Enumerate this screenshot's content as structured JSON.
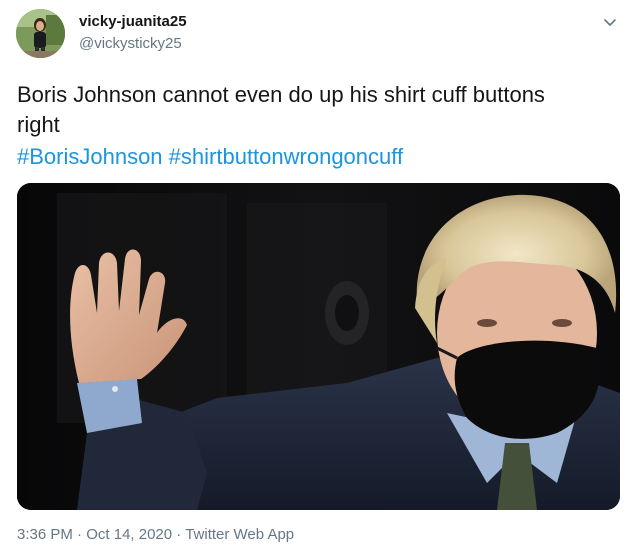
{
  "user": {
    "display_name": "vicky-juanita25",
    "handle": "@vickysticky25",
    "avatar_icon": "profile-avatar"
  },
  "menu": {
    "icon": "chevron-down-icon"
  },
  "tweet": {
    "text_line1": "Boris Johnson cannot even do up his shirt cuff buttons",
    "text_line2": "right",
    "hashtags": [
      "#BorisJohnson",
      "#shirtbuttonwrongoncuff"
    ],
    "media_icon": "photo-man-waving-in-black-face-mask"
  },
  "meta": {
    "time": "3:36 PM",
    "separator": "·",
    "date": "Oct 14, 2020",
    "source": "Twitter Web App"
  },
  "colors": {
    "link": "#1b95e0",
    "secondary_text": "#657786",
    "primary_text": "#14171a"
  }
}
